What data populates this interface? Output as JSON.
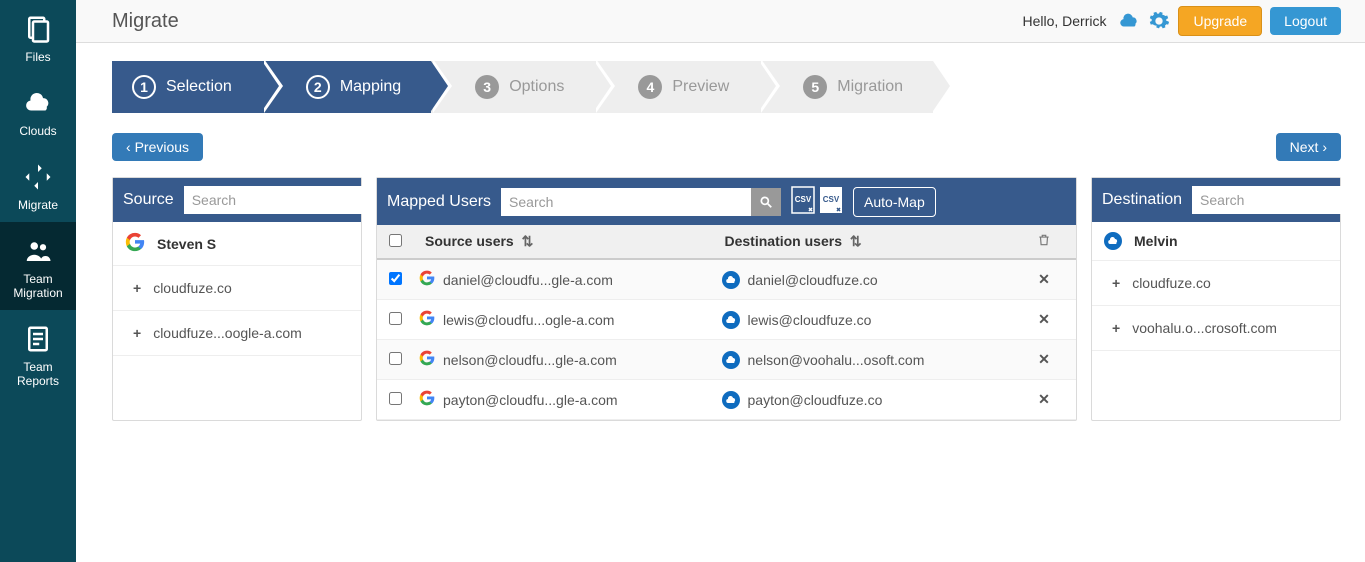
{
  "sidebar": {
    "items": [
      {
        "label": "Files",
        "icon": "files-icon"
      },
      {
        "label": "Clouds",
        "icon": "cloud-icon"
      },
      {
        "label": "Migrate",
        "icon": "migrate-icon"
      },
      {
        "label": "Team Migration",
        "icon": "team-icon"
      },
      {
        "label": "Team Reports",
        "icon": "report-icon"
      }
    ],
    "active": 3
  },
  "header": {
    "title": "Migrate",
    "greeting": "Hello, Derrick",
    "upgrade": "Upgrade",
    "logout": "Logout"
  },
  "wizard": {
    "steps": [
      {
        "num": "1",
        "label": "Selection",
        "active": true
      },
      {
        "num": "2",
        "label": "Mapping",
        "active": true
      },
      {
        "num": "3",
        "label": "Options",
        "active": false
      },
      {
        "num": "4",
        "label": "Preview",
        "active": false
      },
      {
        "num": "5",
        "label": "Migration",
        "active": false
      }
    ],
    "previous": "Previous",
    "next": "Next"
  },
  "source": {
    "title": "Source",
    "search_ph": "Search",
    "user": "Steven S",
    "items": [
      {
        "label": "cloudfuze.co"
      },
      {
        "label": "cloudfuze...oogle-a.com"
      }
    ]
  },
  "destination": {
    "title": "Destination",
    "search_ph": "Search",
    "user": "Melvin",
    "items": [
      {
        "label": "cloudfuze.co"
      },
      {
        "label": "voohalu.o...crosoft.com"
      }
    ]
  },
  "mapped": {
    "title": "Mapped Users",
    "search_ph": "Search",
    "automap": "Auto-Map",
    "col_src": "Source users",
    "col_dst": "Destination users",
    "rows": [
      {
        "src": "daniel@cloudfu...gle-a.com",
        "dst": "daniel@cloudfuze.co",
        "checked": true
      },
      {
        "src": "lewis@cloudfu...ogle-a.com",
        "dst": "lewis@cloudfuze.co",
        "checked": false
      },
      {
        "src": "nelson@cloudfu...gle-a.com",
        "dst": "nelson@voohalu...osoft.com",
        "checked": false
      },
      {
        "src": "payton@cloudfu...gle-a.com",
        "dst": "payton@cloudfuze.co",
        "checked": false
      }
    ]
  }
}
